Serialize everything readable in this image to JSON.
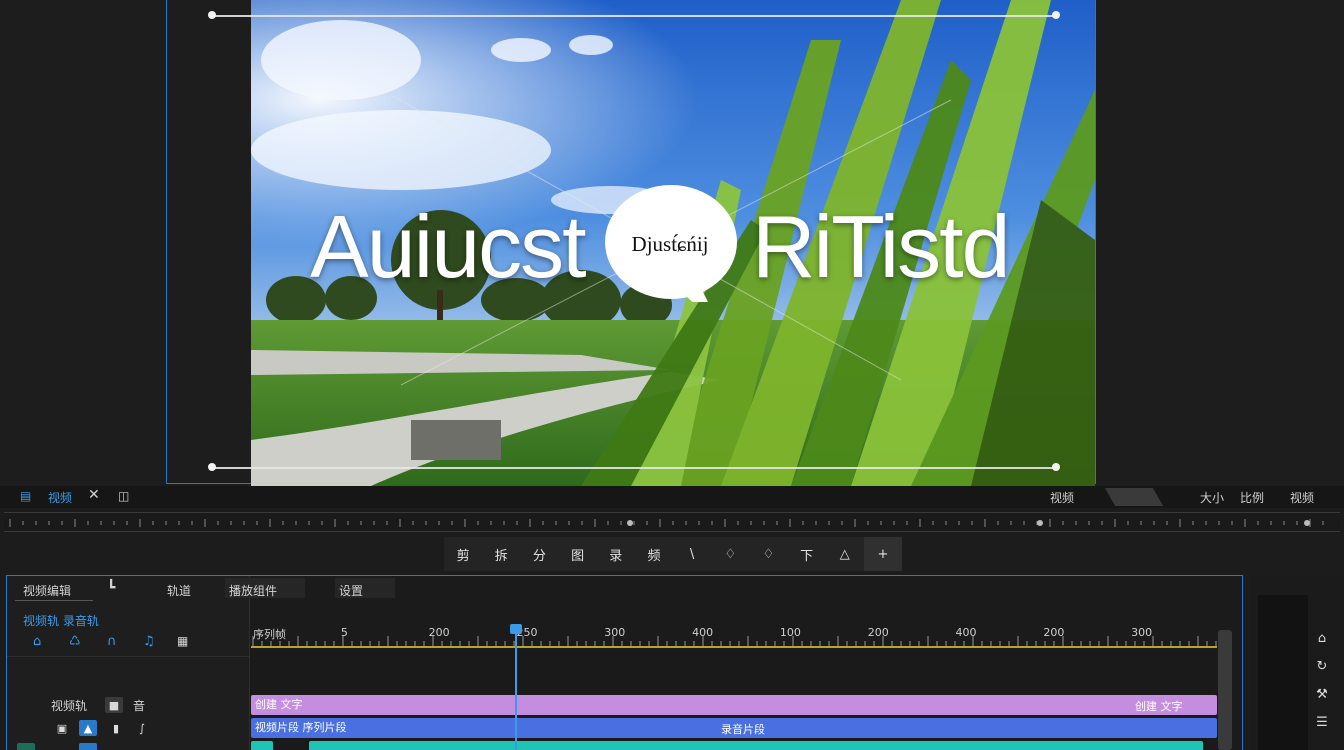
{
  "preview": {
    "title_left": "Auiucst",
    "title_right": "RiTistd",
    "bubble_text": "Djust́ɕńĳ"
  },
  "player_bar": {
    "left_label": "视频",
    "right_label_1": "视频",
    "right_label_2": "大小",
    "right_label_3": "比例",
    "right_label_4": "视频"
  },
  "toolbar": {
    "tools": [
      "剪",
      "拆",
      "分",
      "图",
      "录",
      "频",
      "\\",
      "♢",
      "♢",
      "下",
      "△",
      "+"
    ]
  },
  "timeline": {
    "header_title": "视频编辑",
    "header_tab_2": "轨道",
    "header_tab_3": "播放组件",
    "header_tab_4": "设置",
    "subheader": "视频轨 录音轨",
    "ruler_labels": [
      "序列帧",
      "5",
      "200",
      "250",
      "300",
      "400",
      "100",
      "200",
      "400",
      "200",
      "300"
    ],
    "track_label_1": "视频轨",
    "track_label_2": "音",
    "clip_purple": "创建 文字",
    "clip_purple_end": "创建 文字",
    "clip_blue": "视频片段 序列片段",
    "clip_blue_2": "录音片段"
  },
  "colors": {
    "accent": "#2a78c8",
    "clip_purple": "#c48de0",
    "clip_blue": "#4a6fe0",
    "clip_teal": "#1fc4b4",
    "ruler_line": "#b8a230"
  }
}
